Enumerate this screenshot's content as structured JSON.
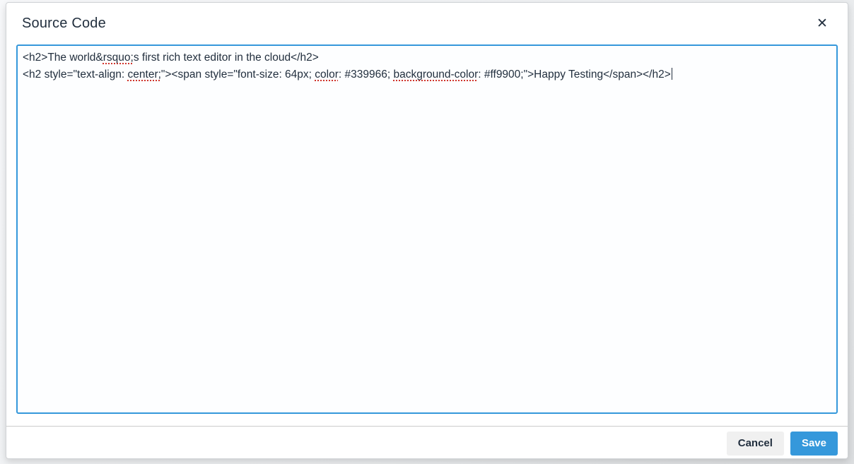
{
  "dialog": {
    "title": "Source Code",
    "close_icon": "✕"
  },
  "source_code": {
    "lines": [
      {
        "caret": false,
        "segments": [
          {
            "t": "<h2>The world&",
            "m": false
          },
          {
            "t": "rsquo;",
            "m": true
          },
          {
            "t": "s first rich text editor in the cloud</h2>",
            "m": false
          }
        ]
      },
      {
        "caret": true,
        "segments": [
          {
            "t": "<h2 style=\"text-align: ",
            "m": false
          },
          {
            "t": "center;",
            "m": true
          },
          {
            "t": "\"><span style=\"font-size: 64px; ",
            "m": false
          },
          {
            "t": "color",
            "m": true
          },
          {
            "t": ": #339966; ",
            "m": false
          },
          {
            "t": "background-color",
            "m": true
          },
          {
            "t": ": #ff9900;\">Happy Testing</span></h2>",
            "m": false
          }
        ]
      }
    ]
  },
  "footer": {
    "cancel_label": "Cancel",
    "save_label": "Save"
  },
  "colors": {
    "accent_blue": "#3598db",
    "text_dark": "#222f3e",
    "misspell_red": "#d0342c",
    "cancel_bg": "#f0f0f0"
  }
}
